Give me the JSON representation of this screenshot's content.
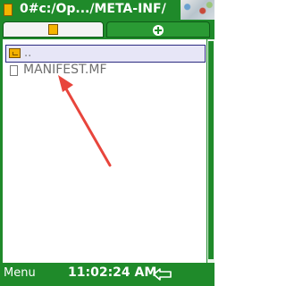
{
  "titlebar": {
    "title": "0#c:/Op.../META-INF/",
    "app_icon": "file-manager-icon"
  },
  "tabs": [
    {
      "name": "files",
      "icon": "document-icon",
      "active": true
    },
    {
      "name": "new",
      "icon": "plus-icon",
      "active": false
    }
  ],
  "list": {
    "items": [
      {
        "label": "..",
        "icon": "folder-up-icon",
        "selected": true
      },
      {
        "label": "MANIFEST.MF",
        "icon": "file-icon",
        "selected": false
      }
    ]
  },
  "annotation": {
    "type": "arrow",
    "color": "#e8453c"
  },
  "bottombar": {
    "menu_label": "Menu",
    "time": "11:02:24 AM",
    "back_icon": "back-arrow-icon"
  },
  "colors": {
    "accent": "#1f8a2a",
    "selection": "#e7e6f7"
  }
}
